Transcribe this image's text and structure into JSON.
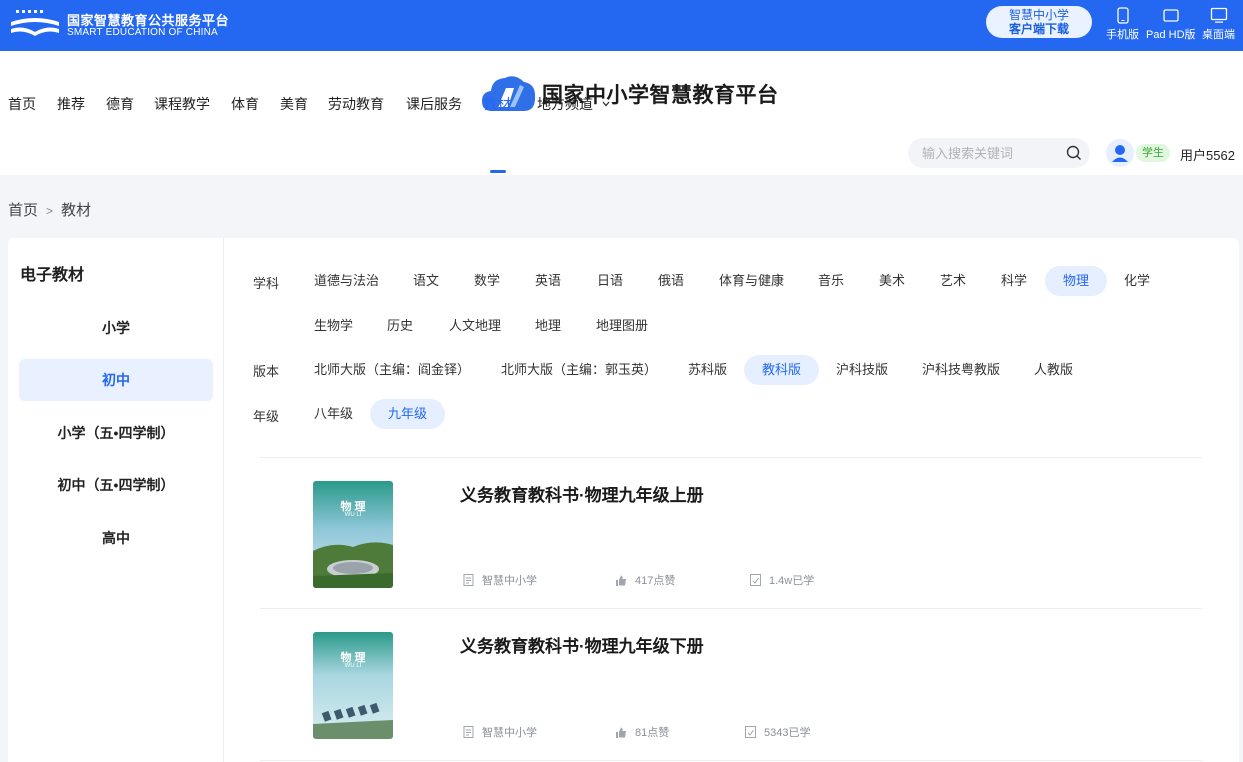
{
  "topbar": {
    "brand_cn": "国家智慧教育公共服务平台",
    "brand_en": "SMART EDUCATION OF CHINA",
    "download_line1": "智慧中小学",
    "download_line2": "客户端下载",
    "devices": [
      {
        "label": "手机版",
        "icon": "phone-icon"
      },
      {
        "label": "Pad HD版",
        "icon": "tablet-icon"
      },
      {
        "label": "桌面端",
        "icon": "desktop-icon"
      }
    ]
  },
  "header": {
    "platform_title": "国家中小学智慧教育平台",
    "nav": [
      "首页",
      "推荐",
      "德育",
      "课程教学",
      "体育",
      "美育",
      "劳动教育",
      "课后服务",
      "教材",
      "地方频道"
    ],
    "nav_active": "教材",
    "search_placeholder": "输入搜索关键词",
    "user_role": "学生",
    "user_name": "用户5562"
  },
  "breadcrumb": {
    "home": "首页",
    "separator": ">",
    "current": "教材"
  },
  "sidebar": {
    "title": "电子教材",
    "items": [
      "小学",
      "初中",
      "小学（五•四学制）",
      "初中（五•四学制）",
      "高中"
    ],
    "active": "初中"
  },
  "filters": {
    "subject_label": "学科",
    "subjects": [
      "道德与法治",
      "语文",
      "数学",
      "英语",
      "日语",
      "俄语",
      "体育与健康",
      "音乐",
      "美术",
      "艺术",
      "科学",
      "物理",
      "化学",
      "生物学",
      "历史",
      "人文地理",
      "地理",
      "地理图册"
    ],
    "subject_active": "物理",
    "edition_label": "版本",
    "editions": [
      "北师大版（主编：阎金铎）",
      "北师大版（主编：郭玉英）",
      "苏科版",
      "教科版",
      "沪科技版",
      "沪科技粤教版",
      "人教版"
    ],
    "edition_active": "教科版",
    "grade_label": "年级",
    "grades": [
      "八年级",
      "九年级"
    ],
    "grade_active": "九年级"
  },
  "books": [
    {
      "title": "义务教育教科书·物理九年级上册",
      "publisher": "智慧中小学",
      "likes": "417点赞",
      "learners": "1.4w已学",
      "cover_title": "物 理",
      "cover_sub": "WU LI"
    },
    {
      "title": "义务教育教科书·物理九年级下册",
      "publisher": "智慧中小学",
      "likes": "81点赞",
      "learners": "5343已学",
      "cover_title": "物 理",
      "cover_sub": "WU LI"
    }
  ],
  "colors": {
    "brand_blue": "#2468f2",
    "active_bg": "#e6efff",
    "tag_green": "#3aa336"
  }
}
